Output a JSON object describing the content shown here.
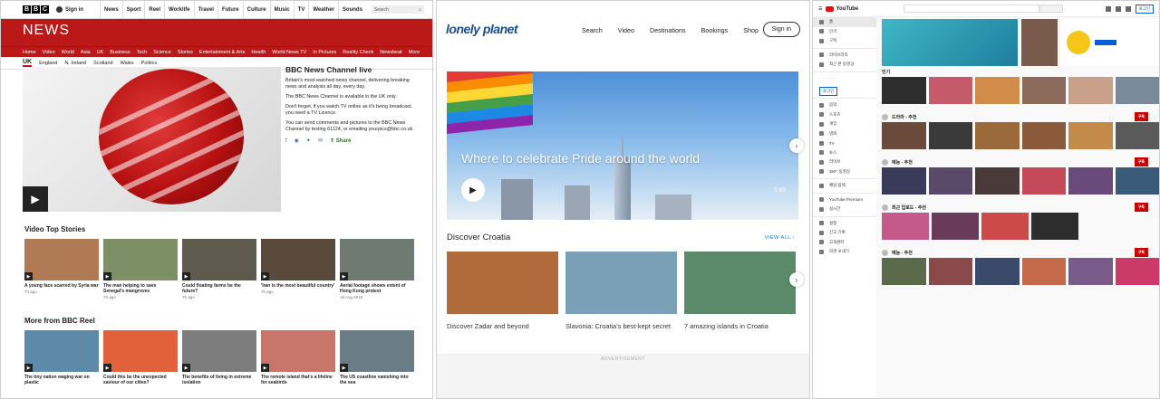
{
  "bbc": {
    "logo": [
      "B",
      "B",
      "C"
    ],
    "sign_in": "Sign in",
    "top_nav": [
      "News",
      "Sport",
      "Reel",
      "Worklife",
      "Travel",
      "Future",
      "Culture",
      "Music",
      "TV",
      "Weather",
      "Sounds"
    ],
    "search_placeholder": "Search",
    "brand": "NEWS",
    "main_nav": [
      "Home",
      "Video",
      "World",
      "Asia",
      "UK",
      "Business",
      "Tech",
      "Science",
      "Stories",
      "Entertainment & Arts",
      "Health",
      "World News TV",
      "In Pictures",
      "Reality Check",
      "Newsbeat",
      "More"
    ],
    "sub_nav": [
      "UK",
      "England",
      "N. Ireland",
      "Scotland",
      "Wales",
      "Politics"
    ],
    "live": {
      "title": "BBC News Channel live",
      "p1": "Britain's most-watched news channel, delivering breaking news and analysis all day, every day.",
      "p2": "The BBC News Channel is available in the UK only.",
      "p3": "Don't forget, if you watch TV online as it's being broadcast, you need a TV Licence.",
      "p4": "You can send comments and pictures to the BBC News Channel by texting 61124, or emailing yourpics@bbc.co.uk.",
      "share": "Share"
    },
    "video_top_title": "Video Top Stories",
    "video_top": [
      {
        "title": "A young face scarred by Syria war",
        "time": "7h ago",
        "color": "#b07a55"
      },
      {
        "title": "The man helping to save Senegal's mangroves",
        "time": "7h ago",
        "color": "#7d8f64"
      },
      {
        "title": "Could floating farms be the future?",
        "time": "7h ago",
        "color": "#5f5a4e"
      },
      {
        "title": "'Iran is the most beautiful country'",
        "time": "7h ago",
        "color": "#5a4a3c"
      },
      {
        "title": "Aerial footage shows extent of Hong Kong protest",
        "time": "18 Aug 2019",
        "color": "#6f7a72"
      }
    ],
    "reel_title": "More from BBC Reel",
    "reel": [
      {
        "title": "The tiny nation waging war on plastic",
        "color": "#5d8aa8"
      },
      {
        "title": "Could this be the unexpected saviour of our cities?",
        "color": "#e2603a"
      },
      {
        "title": "The benefits of living in extreme isolation",
        "color": "#7d7d7d"
      },
      {
        "title": "The remote island that's a lifeline for seabirds",
        "color": "#c9756a"
      },
      {
        "title": "The US coastline vanishing into the sea",
        "color": "#6a7c86"
      }
    ]
  },
  "lonely_planet": {
    "logo": "lonely planet",
    "nav": [
      "Search",
      "Video",
      "Destinations",
      "Bookings",
      "Shop"
    ],
    "sign_in": "Sign in",
    "hero_title": "Where to celebrate Pride around the world",
    "hero_time": "3:45",
    "section_title": "Discover Croatia",
    "view_all": "VIEW ALL",
    "cards": [
      {
        "title": "Discover Zadar and beyond",
        "color": "#b06a3c"
      },
      {
        "title": "Slavonia: Croatia's best-kept secret",
        "color": "#7aa0b8"
      },
      {
        "title": "7 amazing islands in Croatia",
        "color": "#5a8a6a"
      }
    ],
    "advertisement": "ADVERTISEMENT"
  },
  "youtube": {
    "logo": "YouTube",
    "login": "로그인",
    "sidebar": [
      "홈",
      "인기",
      "구독",
      "",
      "라이브러리",
      "최근 본 동영상",
      "",
      "음악",
      "스포츠",
      "게임",
      "영화",
      "TV",
      "뉴스",
      "라이브",
      "360° 동영상",
      "",
      "채널 탐색",
      "",
      "YouTube Premium",
      "실시간",
      "",
      "설정",
      "신고 기록",
      "고객센터",
      "의견 보내기"
    ],
    "trending_title": "인기",
    "rows": [
      {
        "title": "",
        "colors": [
          "#2d2d2d",
          "#c45a6a",
          "#d18c4a",
          "#8a6a5a",
          "#c9a08a",
          "#7a8a9a"
        ]
      },
      {
        "title": "드라마 - 추천",
        "colors": [
          "#6a4a3a",
          "#3a3a3a",
          "#9a6a3a",
          "#8a5a3a",
          "#c48a4a",
          "#5a5a5a"
        ]
      },
      {
        "title": "예능 - 추천",
        "colors": [
          "#3a3a5a",
          "#5a4a6a",
          "#4a3a3a",
          "#c44a5a",
          "#6a4a7a",
          "#3a5a7a"
        ]
      },
      {
        "title": "최근 업로드 - 추천",
        "colors": [
          "#c45a8a",
          "#6a3a5a",
          "#cc4a4a",
          "#2d2d2d"
        ]
      },
      {
        "title": "예능 - 추천",
        "colors": [
          "#5a6a4a",
          "#8a4a4a",
          "#3a4a6a",
          "#c46a4a",
          "#7a5a8a",
          "#cc3a6a"
        ]
      }
    ],
    "subscribe": "구독"
  },
  "colors": {
    "bbc_red": "#bb1919",
    "lp_blue": "#1c4d8c",
    "yt_red": "#cc0000"
  }
}
